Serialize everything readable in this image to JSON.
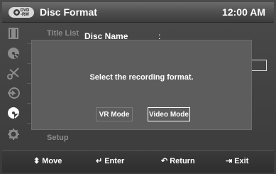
{
  "header": {
    "badge_top": "DVD",
    "badge_bottom": "-RW",
    "title": "Disc Format",
    "time": "12:00 AM"
  },
  "menu": {
    "items": [
      {
        "icon": "film-strip-icon",
        "label": "Title List"
      },
      {
        "icon": "disc-icon",
        "label": ""
      },
      {
        "icon": "scissors-icon",
        "label": ""
      },
      {
        "icon": "copy-icon",
        "label": ""
      },
      {
        "icon": "disc-manager-icon",
        "label": ""
      },
      {
        "icon": "gear-icon",
        "label": "Setup"
      }
    ]
  },
  "content": {
    "field_label": "Disc Name",
    "separator": ":"
  },
  "dialog": {
    "message": "Select the recording format.",
    "vr_mode_label": "VR Mode",
    "video_mode_label": "Video Mode"
  },
  "footer": {
    "move": "Move",
    "enter": "Enter",
    "return": "Return",
    "exit": "Exit"
  }
}
